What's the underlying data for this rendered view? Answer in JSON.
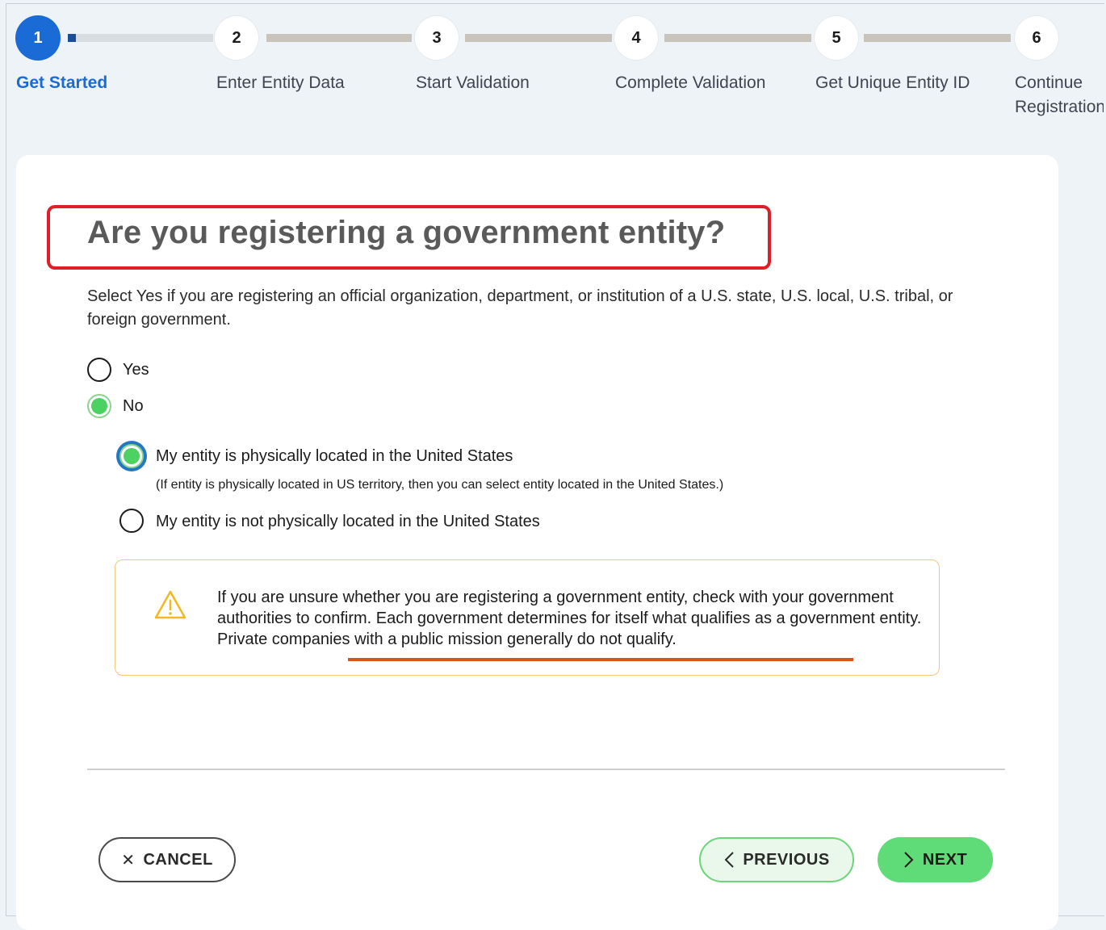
{
  "stepper": {
    "steps": [
      {
        "number": "1",
        "label": "Get Started"
      },
      {
        "number": "2",
        "label": "Enter Entity Data"
      },
      {
        "number": "3",
        "label": "Start Validation"
      },
      {
        "number": "4",
        "label": "Complete Validation"
      },
      {
        "number": "5",
        "label": "Get Unique Entity ID"
      },
      {
        "number": "6",
        "label": "Continue Registration"
      }
    ],
    "active_step": 1
  },
  "question": {
    "title": "Are you registering a government entity?",
    "description": "Select Yes if you are registering an official organization, department, or institution of a U.S. state, U.S. local, U.S. tribal, or foreign government."
  },
  "options": {
    "yes": {
      "label": "Yes",
      "selected": false
    },
    "no": {
      "label": "No",
      "selected": true
    }
  },
  "location_options": {
    "in_us": {
      "label": "My entity is physically located in the United States",
      "selected": true
    },
    "hint": "(If entity is physically located in US territory, then you can select entity located in the United States.)",
    "not_in_us": {
      "label": "My entity is not physically located in the United States",
      "selected": false
    }
  },
  "alert": {
    "icon": "warning-icon",
    "text": "If you are unsure whether you are registering a government entity, check with your government authorities to confirm. Each government determines for itself what qualifies as a government entity. Private companies with a public mission generally do not qualify."
  },
  "buttons": {
    "cancel": "CANCEL",
    "previous": "PREVIOUS",
    "next": "NEXT"
  },
  "colors": {
    "primary": "#1a6bd6",
    "success": "#5fdc78",
    "highlight_box": "#e01e25",
    "underline": "#d9531e",
    "alert_border": "#f4c779"
  }
}
